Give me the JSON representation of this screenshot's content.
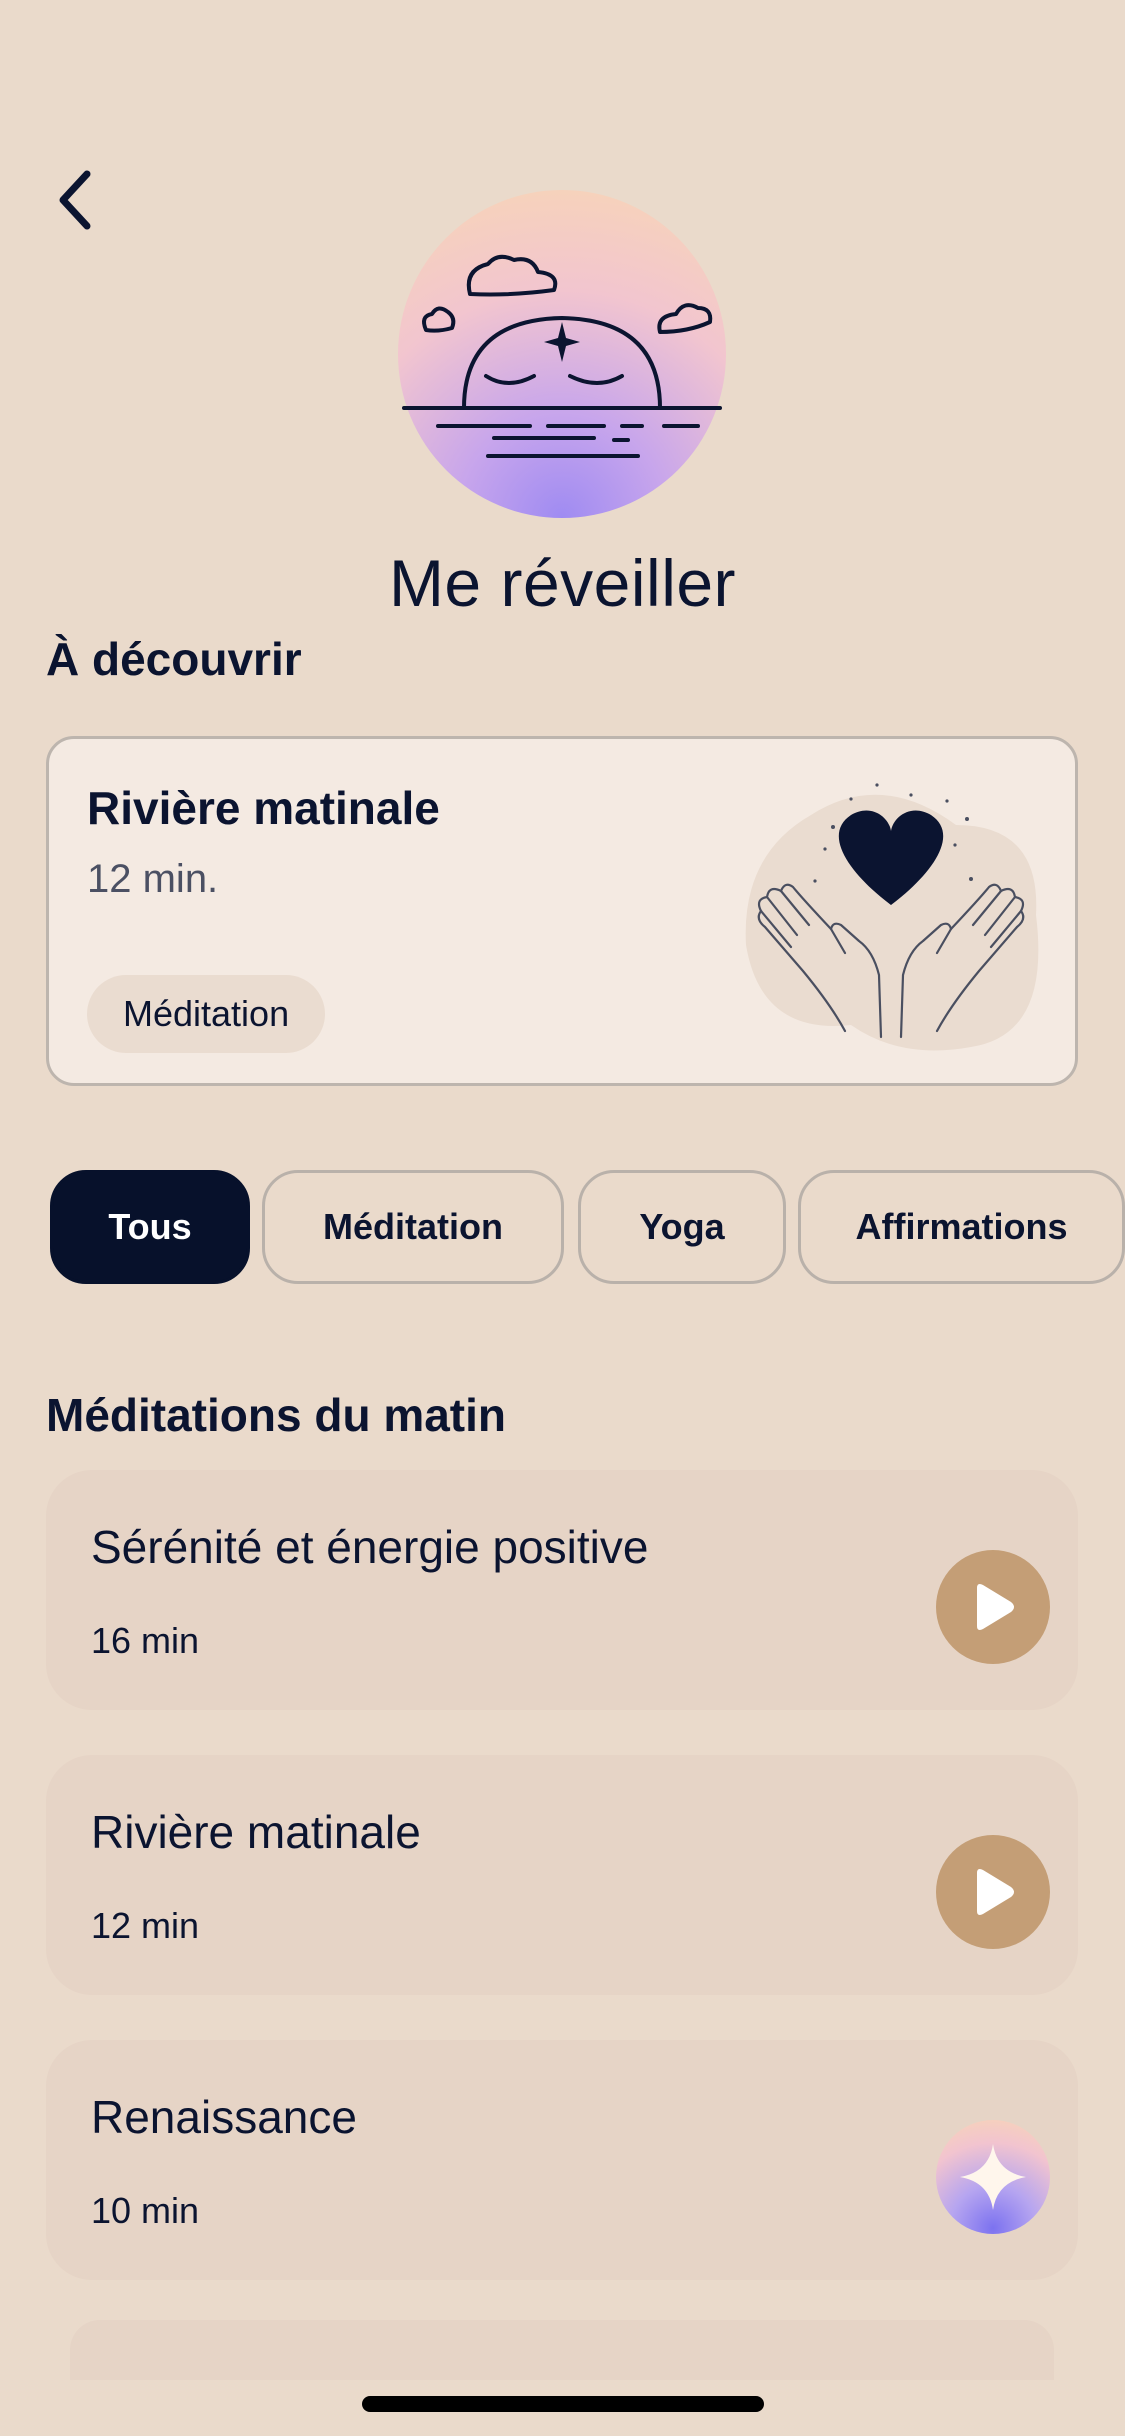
{
  "header": {
    "title": "Me réveiller",
    "back_icon": "chevron-left-icon"
  },
  "hero": {
    "illustration": "sunrise-illustration"
  },
  "discover": {
    "section_title": "À découvrir",
    "card": {
      "title": "Rivière matinale",
      "duration": "12 min.",
      "tag": "Méditation",
      "illustration": "hands-heart-illustration"
    }
  },
  "filters": [
    {
      "label": "Tous",
      "active": true
    },
    {
      "label": "Méditation",
      "active": false
    },
    {
      "label": "Yoga",
      "active": false
    },
    {
      "label": "Affirmations",
      "active": false
    }
  ],
  "list": {
    "section_title": "Méditations du matin",
    "items": [
      {
        "title": "Sérénité et énergie positive",
        "duration": "16 min",
        "action_icon": "play-icon"
      },
      {
        "title": "Rivière matinale",
        "duration": "12 min",
        "action_icon": "play-icon"
      },
      {
        "title": "Renaissance",
        "duration": "10 min",
        "action_icon": "sparkle-icon"
      }
    ]
  },
  "colors": {
    "background": "#EADACB",
    "text": "#0B1430",
    "accent": "#C49E76",
    "chip_active": "#07112B"
  }
}
